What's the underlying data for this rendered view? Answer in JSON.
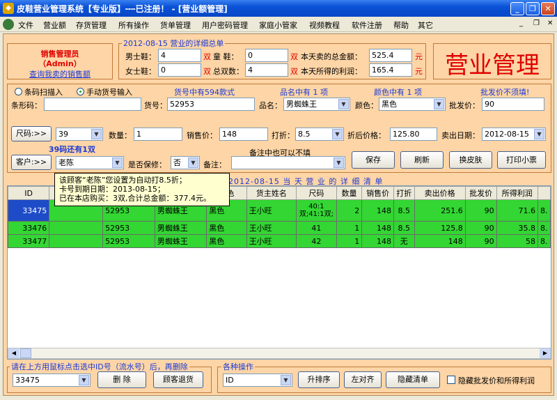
{
  "window": {
    "title": "皮鞋营业管理系统【专业版】┅┅已注册！ - [营业额管理]"
  },
  "menu": {
    "items": [
      "文件",
      "营业额",
      "存货管理",
      "所有操作",
      "货单管理",
      "用户密码管理",
      "家庭小管家",
      "视频教程",
      "软件注册",
      "帮助",
      "其它"
    ]
  },
  "user": {
    "role": "销售管理员",
    "name": "（Admin）",
    "link": "查询我卖的销售额"
  },
  "summary": {
    "title": "2012-08-15 营业的详细总单",
    "men_label": "男士鞋：",
    "men_value": "4",
    "women_label": "女士鞋：",
    "women_value": "0",
    "pair": "双",
    "kids_label": "童  鞋：",
    "kids_value": "0",
    "total_pairs_label": "总双数：",
    "total_pairs_value": "4",
    "total_amount_label": "本天卖的总金额：",
    "total_amount_value": "525.4",
    "profit_label": "本天所得的利润：",
    "profit_value": "165.4",
    "yuan": "元"
  },
  "big_title": "营业管理",
  "entry": {
    "radio_scan": "条码扫描入",
    "radio_manual": "手动货号输入",
    "hint_goods": "货号中有594款式",
    "hint_name": "品名中有 1 项",
    "hint_color": "颜色中有 1 项",
    "hint_wholesale": "批发价不须填!",
    "barcode_label": "条形码：",
    "barcode_value": "",
    "goods_no_label": "货号：",
    "goods_no_value": "52953",
    "name_label": "品名：",
    "name_value": "男蜘蛛王",
    "color_label": "颜色：",
    "color_value": "黑色",
    "wholesale_label": "批发价：",
    "wholesale_value": "90",
    "size_button": "尺码:>>",
    "size_value": "39",
    "qty_label": "数量：",
    "qty_value": "1",
    "price_label": "销售价：",
    "price_value": "148",
    "discount_label": "打折：",
    "discount_value": "8.5",
    "after_discount_label": "折后价格：",
    "after_discount_value": "125.80",
    "date_label": "卖出日期：",
    "date_value": "2012-08-15",
    "stock_hint": "39码还有1双",
    "customer_button": "客户:>>",
    "customer_value": "老陈",
    "warranty_label": "是否保修：",
    "warranty_value": "否",
    "remark_label": "备注：",
    "remark_value": "",
    "remark_hint": "备注中也可以不填",
    "save_button": "保存",
    "refresh_button": "刷新",
    "skin_button": "换皮肤",
    "print_button": "打印小票"
  },
  "list_title": "2012-08-15 当 天 营 业 的 详 细 清 单",
  "tooltip": {
    "line1": "该顾客“老陈”您设置为自动打8.5折；",
    "line2": "卡号到期日期：2013-08-15；",
    "line3": "已在本店购买：3双,合计总金额：377.4元。"
  },
  "table": {
    "headers": [
      "ID",
      "",
      "货号",
      "品名",
      "颜色",
      "货主姓名",
      "尺码",
      "数量",
      "销售价",
      "打折",
      "卖出价格",
      "批发价",
      "所得利润",
      ""
    ],
    "rows": [
      [
        "33475",
        "",
        "52953",
        "男蜘蛛王",
        "黑色",
        "王小旺",
        "40:1双;41:1双;",
        "2",
        "148",
        "8.5",
        "251.6",
        "90",
        "71.6",
        "8."
      ],
      [
        "33476",
        "",
        "52953",
        "男蜘蛛王",
        "黑色",
        "王小旺",
        "41",
        "1",
        "148",
        "8.5",
        "125.8",
        "90",
        "35.8",
        "8."
      ],
      [
        "33477",
        "",
        "52953",
        "男蜘蛛王",
        "黑色",
        "王小旺",
        "42",
        "1",
        "148",
        "无",
        "148",
        "90",
        "58",
        "8."
      ]
    ]
  },
  "bottom": {
    "delete_group_title": "请在上方用鼠标点击选中ID号（流水号）后，再删除",
    "id_value": "33475",
    "delete_button": "删 除",
    "return_button": "顾客退货",
    "ops_group_title": "各种操作",
    "sort_field": "ID",
    "asc_button": "升排序",
    "align_button": "左对齐",
    "hide_button": "隐藏清单",
    "hide_check_label": "隐藏批发价和所得利润"
  }
}
